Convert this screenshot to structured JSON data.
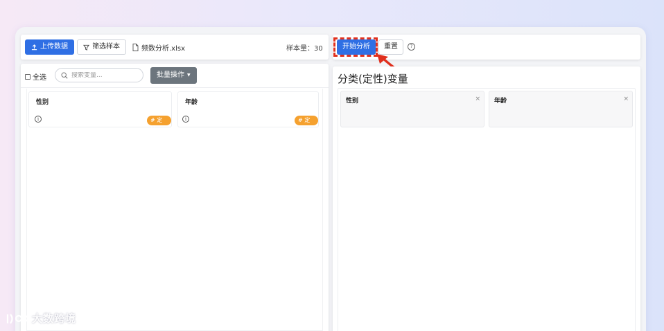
{
  "toolbar": {
    "upload_label": "上传数据",
    "filter_label": "筛选样本",
    "file_name": "频数分析.xlsx",
    "sample_size_label": "样本量：30"
  },
  "actions": {
    "start_label": "开始分析",
    "reset_label": "重置",
    "help_symbol": "?"
  },
  "left_panel": {
    "select_all_label": "全选",
    "search_placeholder": "搜索变量...",
    "batch_label": "批量操作",
    "variables": [
      {
        "name": "性别",
        "badge": "# 定性"
      },
      {
        "name": "年龄",
        "badge": "# 定性"
      }
    ]
  },
  "right_panel": {
    "section_title": "分类(定性)变量",
    "selected": [
      {
        "name": "性别",
        "remove": "×"
      },
      {
        "name": "年龄",
        "remove": "×"
      }
    ]
  },
  "watermark": {
    "text": "大数跨境"
  },
  "colors": {
    "primary": "#2f6fe4",
    "badge": "#f5a12f",
    "highlight": "#e0301e"
  }
}
